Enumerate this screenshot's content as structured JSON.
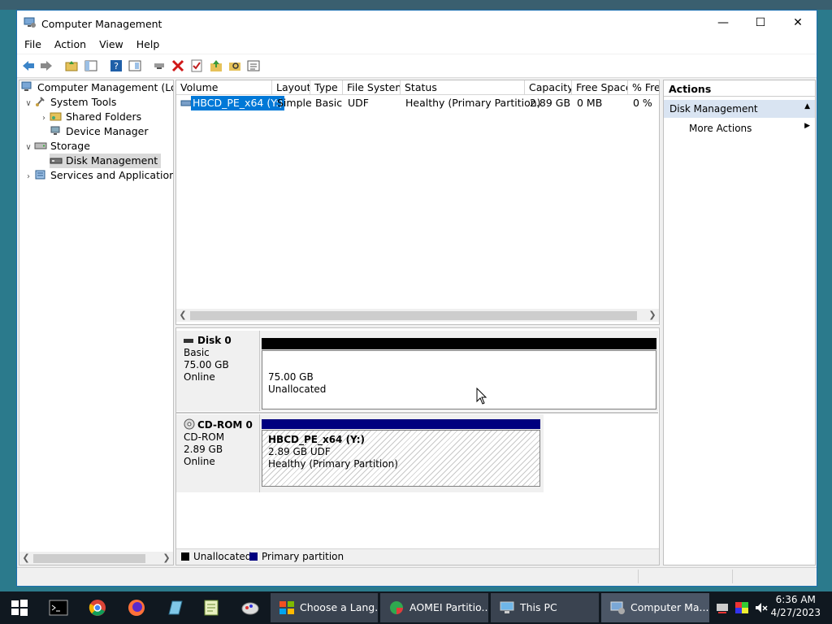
{
  "window": {
    "title": "Computer Management",
    "menu": [
      "File",
      "Action",
      "View",
      "Help"
    ]
  },
  "tree": {
    "root": "Computer Management (Local",
    "system_tools": "System Tools",
    "shared_folders": "Shared Folders",
    "device_manager": "Device Manager",
    "storage": "Storage",
    "disk_management": "Disk Management",
    "services": "Services and Applications"
  },
  "volume_list": {
    "columns": [
      "Volume",
      "Layout",
      "Type",
      "File System",
      "Status",
      "Capacity",
      "Free Space",
      "% Free"
    ],
    "rows": [
      {
        "volume": "HBCD_PE_x64 (Y:)",
        "layout": "Simple",
        "type": "Basic",
        "fs": "UDF",
        "status": "Healthy (Primary Partition)",
        "capacity": "2.89 GB",
        "free": "0 MB",
        "pct": "0 %"
      }
    ]
  },
  "disks": [
    {
      "name": "Disk 0",
      "kind": "Basic",
      "size": "75.00 GB",
      "state": "Online",
      "partition": {
        "size": "75.00 GB",
        "label": "Unallocated"
      }
    },
    {
      "name": "CD-ROM 0",
      "kind": "CD-ROM",
      "size": "2.89 GB",
      "state": "Online",
      "partition": {
        "title": "HBCD_PE_x64  (Y:)",
        "size": "2.89 GB UDF",
        "status": "Healthy (Primary Partition)"
      }
    }
  ],
  "legend": {
    "unallocated": "Unallocated",
    "primary": "Primary partition"
  },
  "actions": {
    "header": "Actions",
    "section": "Disk Management",
    "more": "More Actions"
  },
  "taskbar": {
    "tasks": [
      "Choose a Lang...",
      "AOMEI Partitio...",
      "This PC",
      "Computer Ma..."
    ],
    "time": "6:36 AM",
    "date": "4/27/2023"
  },
  "colors": {
    "unallocated": "#000000",
    "primary": "#00007f",
    "selection": "#0078d7",
    "actions_section": "#d9e4f2"
  }
}
